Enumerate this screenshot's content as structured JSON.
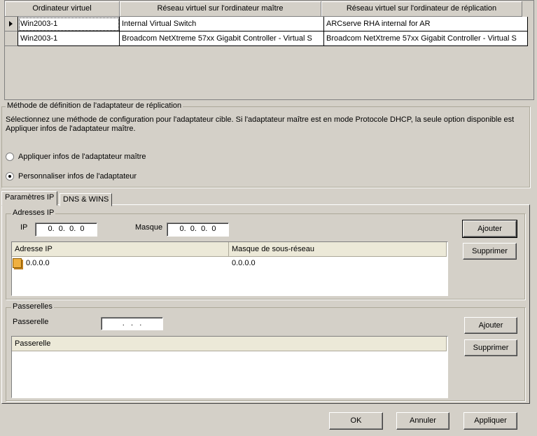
{
  "grid": {
    "headers": [
      "Ordinateur virtuel",
      "Réseau virtuel sur l'ordinateur maître",
      "Réseau virtuel sur l'ordinateur de réplication"
    ],
    "rows": [
      [
        "Win2003-1",
        "Internal Virtual Switch",
        "ARCserve RHA internal for AR"
      ],
      [
        "Win2003-1",
        "Broadcom NetXtreme 57xx Gigabit Controller - Virtual S",
        "Broadcom NetXtreme 57xx Gigabit Controller - Virtual S"
      ]
    ]
  },
  "method": {
    "title": "Méthode de définition de l'adaptateur de réplication",
    "description_line1": "Sélectionnez une méthode de configuration pour l'adaptateur cible. Si l'adaptateur maître est en mode Protocole DHCP, la seule option disponible est",
    "description_line2": "Appliquer infos de l'adaptateur maître.",
    "option_apply": "Appliquer infos de l'adaptateur maître",
    "option_custom": "Personnaliser infos de l'adaptateur",
    "selected": "custom"
  },
  "tabs": [
    "Paramètres IP",
    "DNS & WINS"
  ],
  "ip": {
    "group": "Adresses IP",
    "ip_label": "IP",
    "ip_value": "0.  0.  0.  0",
    "mask_label": "Masque",
    "mask_value": "0.  0.  0.  0",
    "add": "Ajouter",
    "remove": "Supprimer",
    "columns": [
      "Adresse IP",
      "Masque de sous-réseau"
    ],
    "rows": [
      [
        "0.0.0.0",
        "0.0.0.0"
      ]
    ]
  },
  "gateways": {
    "group": "Passerelles",
    "label": "Passerelle",
    "value": " .   .   . ",
    "add": "Ajouter",
    "remove": "Supprimer",
    "columns": [
      "Passerelle"
    ]
  },
  "footer": {
    "ok": "OK",
    "cancel": "Annuler",
    "apply": "Appliquer"
  }
}
